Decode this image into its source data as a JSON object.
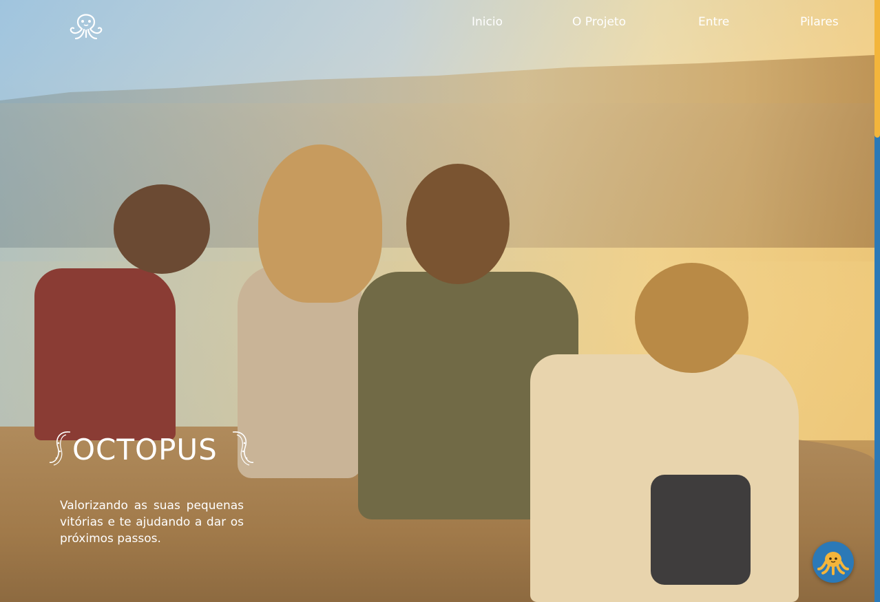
{
  "header": {
    "logo_icon": "octopus-icon",
    "nav": [
      {
        "label": "Inicio"
      },
      {
        "label": "O Projeto"
      },
      {
        "label": "Entre"
      },
      {
        "label": "Pilares"
      }
    ]
  },
  "hero": {
    "brand": "OCTOPUS",
    "tagline": "Valorizando as suas pequenas vitórias e te ajudando a dar os próximos passos."
  },
  "chat": {
    "icon": "octopus-mascot-icon"
  },
  "colors": {
    "accent_blue": "#2b79b7",
    "accent_yellow": "#f3b53b",
    "text_white": "#ffffff"
  }
}
